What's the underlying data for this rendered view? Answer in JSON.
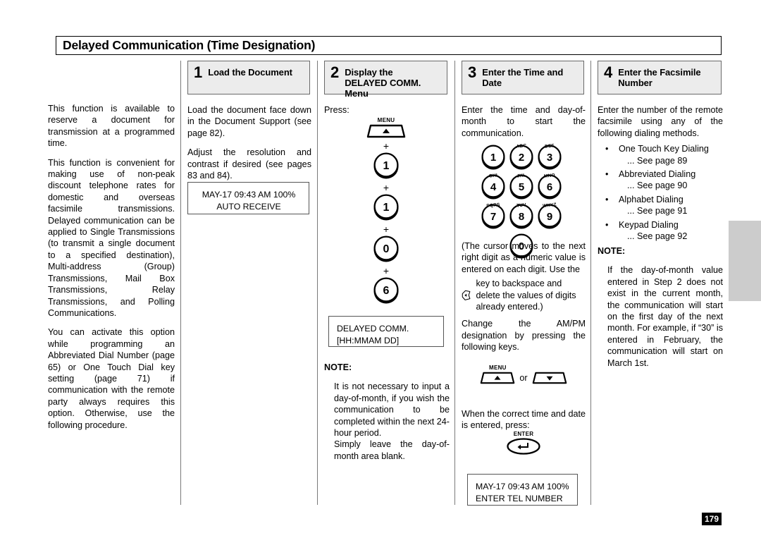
{
  "page": {
    "title": "Delayed Communication (Time Designation)",
    "page_number": "179"
  },
  "intro": {
    "paragraphs": [
      "This function is available to reserve a document for transmission at a programmed time.",
      "This function is convenient for making use of non-peak discount telephone rates for domestic and overseas facsimile transmissions. Delayed communication can be applied to Single Transmissions (to transmit a single document to a specified destination), Multi-address (Group) Transmissions, Mail Box Transmissions, Relay Transmissions, and Polling Communications.",
      "You can activate this option while programming an Abbreviated Dial Number (page 65) or One Touch Dial key setting (page 71) if communication with the remote party always requires this option. Otherwise, use the following procedure."
    ]
  },
  "steps": [
    {
      "number": "1",
      "label": "Load the Document"
    },
    {
      "number": "2",
      "label": "Display the\nDELAYED COMM.\nMenu"
    },
    {
      "number": "3",
      "label": "Enter the Time and\nDate"
    },
    {
      "number": "4",
      "label": "Enter the Facsimile\nNumber"
    }
  ],
  "step1": {
    "paragraphs": [
      "Load the document face down in the Document Support (see page 82).",
      "Adjust the resolution and contrast if desired (see pages 83 and 84)."
    ],
    "display": {
      "line1": "MAY-17 09:43 AM 100%",
      "line2": "AUTO RECEIVE"
    }
  },
  "step2": {
    "press_label": "Press:",
    "key_sequence": [
      {
        "type": "menu-up",
        "caption": "MENU"
      },
      {
        "type": "plus",
        "label": "+"
      },
      {
        "type": "round",
        "label": "1"
      },
      {
        "type": "plus",
        "label": "+"
      },
      {
        "type": "round",
        "label": "1"
      },
      {
        "type": "plus",
        "label": "+"
      },
      {
        "type": "round",
        "label": "0"
      },
      {
        "type": "plus",
        "label": "+"
      },
      {
        "type": "round",
        "label": "6"
      }
    ],
    "display": {
      "line1": "DELAYED COMM.",
      "line2": "[HH:MMAM DD]"
    },
    "note": {
      "heading": "NOTE:",
      "body": "It is not necessary to input a day-of-month, if you wish the communication to be completed within the next 24-hour period.\nSimply leave the day-of-month area blank."
    }
  },
  "step3": {
    "intro": "Enter the time and day-of-month to start the communication.",
    "keypad": [
      [
        {
          "digit": "1",
          "letters": ""
        },
        {
          "digit": "2",
          "letters": "ABC"
        },
        {
          "digit": "3",
          "letters": "DEF"
        }
      ],
      [
        {
          "digit": "4",
          "letters": "GHI"
        },
        {
          "digit": "5",
          "letters": "JKL"
        },
        {
          "digit": "6",
          "letters": "MNO"
        }
      ],
      [
        {
          "digit": "7",
          "letters": "PQRS"
        },
        {
          "digit": "8",
          "letters": "TUV"
        },
        {
          "digit": "9",
          "letters": "WXYZ"
        }
      ],
      [
        {
          "digit": "0",
          "letters": ""
        }
      ]
    ],
    "cursor_note_part1": "(The cursor moves to the next right digit as a numeric value is entered on each digit. Use the",
    "cursor_note_key": "key to backspace and delete the values of digits already entered.)",
    "ampm_text": "Change the AM/PM designation by pressing the following keys.",
    "menu_caption": "MENU",
    "or_label": "or",
    "confirm_text": "When the correct time and date is entered, press:",
    "enter_caption": "ENTER",
    "display": {
      "line1": "MAY-17 09:43 AM 100%",
      "line2": "ENTER TEL NUMBER"
    }
  },
  "step4": {
    "intro": "Enter the number of the remote facsimile using any of the following dialing methods.",
    "methods": [
      {
        "bullet": "•",
        "name": "One Touch Key Dialing",
        "ref": "... See page 89"
      },
      {
        "bullet": "•",
        "name": "Abbreviated Dialing",
        "ref": "... See page 90"
      },
      {
        "bullet": "•",
        "name": "Alphabet Dialing",
        "ref": "... See page 91"
      },
      {
        "bullet": "•",
        "name": "Keypad Dialing",
        "ref": "... See page 92"
      }
    ],
    "note": {
      "heading": "NOTE:",
      "body": "If the day-of-month value entered in Step 2 does not exist in the current month, the communication will start on the first day of the next month. For example, if “30” is entered in February, the communication will start on March 1st."
    }
  },
  "colors": {
    "step_box_bg": "#ececec",
    "tab_marker": "#cccccc",
    "page_num_bg": "#000000"
  }
}
